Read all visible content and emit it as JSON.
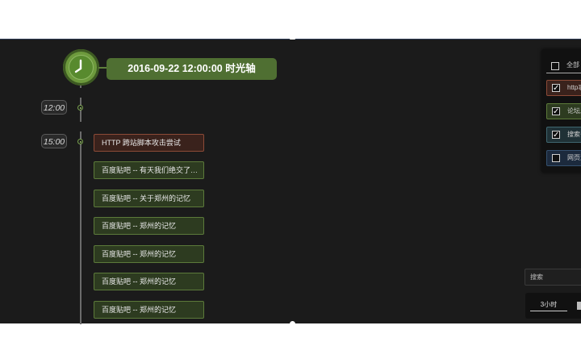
{
  "timeline": {
    "header_title": "2016-09-22 12:00:00   时光轴",
    "time_markers": [
      "12:00",
      "15:00"
    ],
    "events": [
      {
        "label": "HTTP 跨站脚本攻击尝试",
        "status_color": "#8c4a37"
      },
      {
        "label": "百度贴吧 -- 有天我们绝交了、……",
        "status_color": "#5c7a3a"
      },
      {
        "label": "百度贴吧 -- 关于郑州的记忆",
        "status_color": "#5c7a3a"
      },
      {
        "label": "百度贴吧 -- 郑州的记忆",
        "status_color": "#5c7a3a"
      },
      {
        "label": "百度贴吧 -- 郑州的记忆",
        "status_color": "#5c7a3a"
      },
      {
        "label": "百度贴吧 -- 郑州的记忆",
        "status_color": "#5c7a3a"
      },
      {
        "label": "百度贴吧 -- 郑州的记忆",
        "status_color": "#5c7a3a"
      }
    ]
  },
  "filter_panel": {
    "all_label": "全部",
    "items": [
      {
        "label": "http事",
        "checked": true,
        "color": "#3a221c"
      },
      {
        "label": "论坛发",
        "checked": true,
        "color": "#2d3b20"
      },
      {
        "label": "搜索引",
        "checked": true,
        "color": "#1f3136"
      },
      {
        "label": "网页浏",
        "checked": false,
        "color": "#1c2a3d"
      }
    ],
    "check_mark": "✓"
  },
  "search": {
    "label": "搜索"
  },
  "range": {
    "label": "3小时"
  },
  "icons": {
    "clock": "clock-icon"
  }
}
